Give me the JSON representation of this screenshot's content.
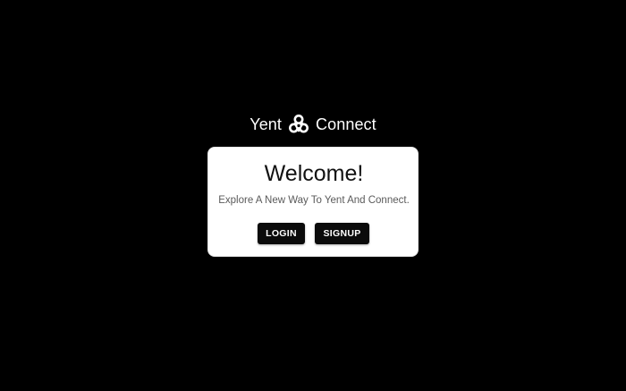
{
  "brand": {
    "name_left": "Yent",
    "name_right": "Connect",
    "logo_icon": "knot-logo-icon"
  },
  "card": {
    "title": "Welcome!",
    "subtitle": "Explore A New Way To Yent And Connect.",
    "login_label": "LOGIN",
    "signup_label": "SIGNUP"
  },
  "colors": {
    "background": "#000000",
    "card": "#ffffff",
    "button": "#0b0b0b",
    "button_text": "#ffffff"
  }
}
